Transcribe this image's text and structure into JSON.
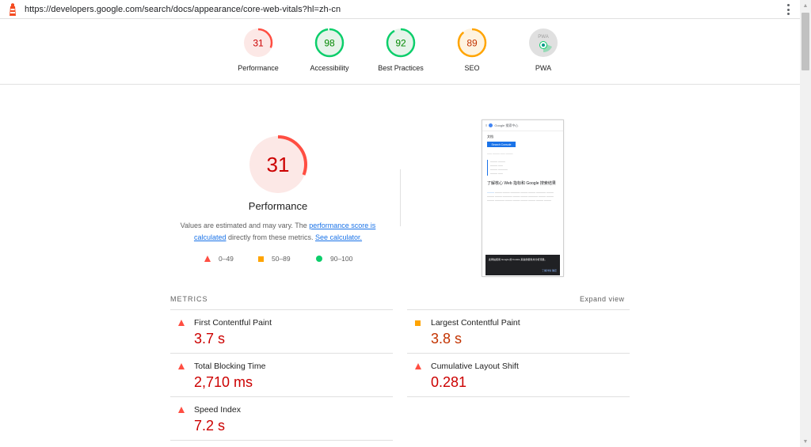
{
  "browser": {
    "url": "https://developers.google.com/search/docs/appearance/core-web-vitals?hl=zh-cn"
  },
  "categories": [
    {
      "name": "Performance",
      "score": "31",
      "score_value": 31,
      "color": "#ff4e42",
      "bg": "#fce8e6",
      "text_color": "#c00"
    },
    {
      "name": "Accessibility",
      "score": "98",
      "score_value": 98,
      "color": "#0cce6b",
      "bg": "#e6f4ea",
      "text_color": "#008800"
    },
    {
      "name": "Best Practices",
      "score": "92",
      "score_value": 92,
      "color": "#0cce6b",
      "bg": "#e6f4ea",
      "text_color": "#008800"
    },
    {
      "name": "SEO",
      "score": "89",
      "score_value": 89,
      "color": "#ffa400",
      "bg": "#fef3e0",
      "text_color": "#c33300"
    },
    {
      "name": "PWA",
      "score": "PWA",
      "color": "#0cce6b",
      "bg": "#e0e0e0"
    }
  ],
  "main": {
    "score": "31",
    "score_value": 31,
    "title": "Performance",
    "desc_before": "Values are estimated and may vary. The ",
    "desc_link1": "performance score is calculated",
    "desc_middle": " directly from these metrics. ",
    "desc_link2": "See calculator."
  },
  "legend": [
    {
      "range": "0–49",
      "shape": "triangle",
      "color": "#ff4e42"
    },
    {
      "range": "50–89",
      "shape": "square",
      "color": "#ffa400"
    },
    {
      "range": "90–100",
      "shape": "circle",
      "color": "#0cce6b"
    }
  ],
  "thumbnail": {
    "site_name": "Google 搜索中心",
    "nav_label": "文档",
    "button": "Search Console",
    "heading": "了解核心 Web 指标和 Google 搜索结果",
    "banner": "此网站使用 Google 的 Cookie 来提供服务并分析流量。",
    "banner_links": "了解详情   确定"
  },
  "metrics_header": "METRICS",
  "expand_view": "Expand view",
  "metrics": [
    {
      "title": "First Contentful Paint",
      "value": "3.7 s",
      "rating": "fail"
    },
    {
      "title": "Largest Contentful Paint",
      "value": "3.8 s",
      "rating": "average"
    },
    {
      "title": "Total Blocking Time",
      "value": "2,710 ms",
      "rating": "fail"
    },
    {
      "title": "Cumulative Layout Shift",
      "value": "0.281",
      "rating": "fail"
    },
    {
      "title": "Speed Index",
      "value": "7.2 s",
      "rating": "fail"
    }
  ]
}
